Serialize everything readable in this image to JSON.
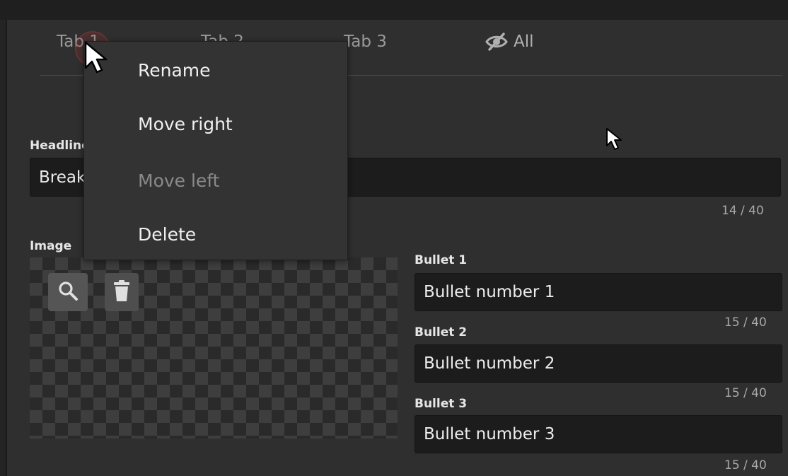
{
  "tabs": [
    {
      "label": "Tab 1"
    },
    {
      "label": "Tab 2"
    },
    {
      "label": "Tab 3"
    },
    {
      "label": "All",
      "icon": "eye-slash-icon"
    }
  ],
  "context_menu": {
    "items": [
      {
        "label": "Rename",
        "enabled": true
      },
      {
        "label": "Move right",
        "enabled": true
      },
      {
        "label": "Move left",
        "enabled": false
      },
      {
        "label": "Delete",
        "enabled": true
      }
    ]
  },
  "headline": {
    "label": "Headline",
    "value": "Breaking news!",
    "counter": "14 / 40"
  },
  "image": {
    "label": "Image",
    "search_icon": "search-icon",
    "delete_icon": "trash-icon"
  },
  "bullets": [
    {
      "label": "Bullet 1",
      "value": "Bullet number 1",
      "counter": "15 / 40"
    },
    {
      "label": "Bullet 2",
      "value": "Bullet number 2",
      "counter": "15 / 40"
    },
    {
      "label": "Bullet 3",
      "value": "Bullet number 3",
      "counter": "15 / 40"
    }
  ],
  "colors": {
    "background": "#2f2f2f",
    "field": "#1c1c1c",
    "menu": "#333333",
    "disabled_text": "#8a8a8a"
  }
}
